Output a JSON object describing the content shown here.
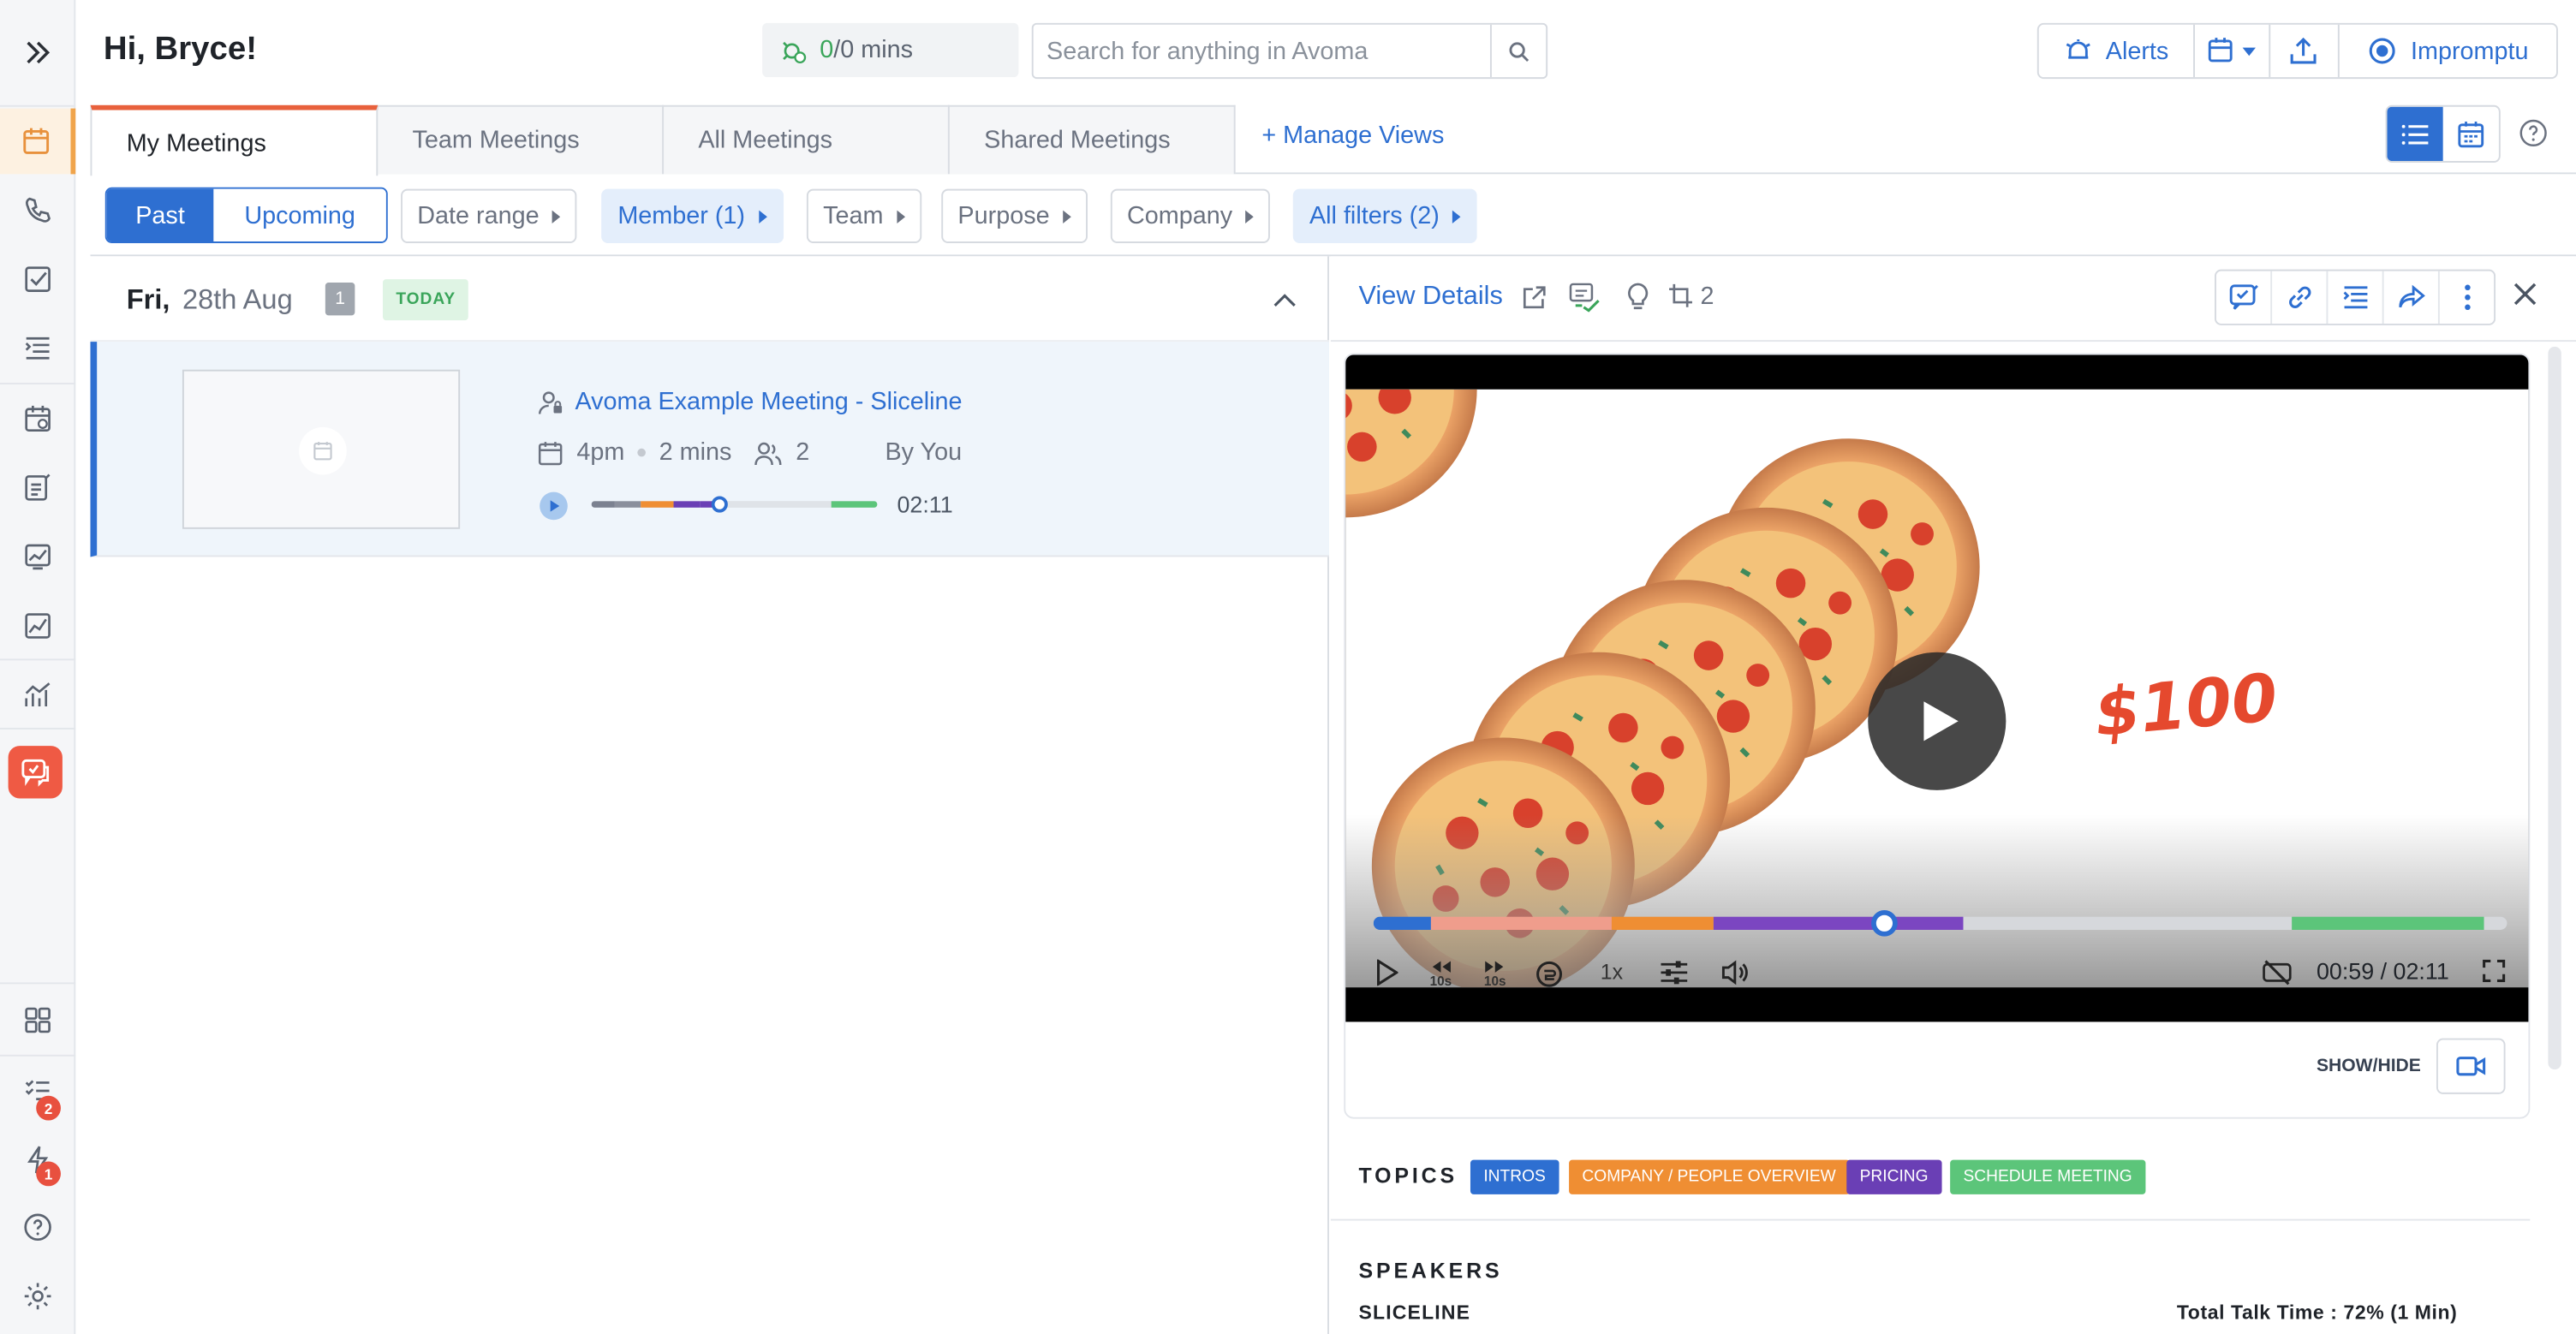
{
  "header": {
    "greeting": "Hi, Bryce!",
    "mins_used": "0",
    "mins_total": "/0 mins",
    "search_placeholder": "Search for anything in Avoma",
    "alerts_label": "Alerts",
    "impromptu_label": "Impromptu"
  },
  "tabs": [
    {
      "label": "My Meetings",
      "active": true
    },
    {
      "label": "Team Meetings"
    },
    {
      "label": "All Meetings"
    },
    {
      "label": "Shared Meetings"
    }
  ],
  "manage_views": "+ Manage Views",
  "filters": {
    "past": "Past",
    "upcoming": "Upcoming",
    "chips": [
      "Date range",
      "Member (1)",
      "Team",
      "Purpose",
      "Company",
      "All filters (2)"
    ]
  },
  "day_group": {
    "day": "Fri,",
    "date": "28th Aug",
    "count": "1",
    "badge": "TODAY"
  },
  "meeting": {
    "title": "Avoma Example Meeting - Sliceline",
    "time": "4pm",
    "length": "2 mins",
    "attendees": "2",
    "owner": "By You",
    "duration": "02:11",
    "progress_fraction": 0.45
  },
  "detail": {
    "view_details": "View Details",
    "clip_count": "2",
    "video": {
      "price_text": "$100",
      "current_time": "00:59",
      "total_time": "02:11",
      "time_display": "00:59 / 02:11",
      "speed": "1x",
      "skip_back": "10s",
      "skip_fwd": "10s",
      "progress_fraction": 0.45
    },
    "show_hide": "SHOW/HIDE",
    "topics_label": "TOPICS",
    "topics": [
      {
        "label": "INTROS",
        "color": "#2e6fd1"
      },
      {
        "label": "COMPANY / PEOPLE OVERVIEW",
        "color": "#ef8e33"
      },
      {
        "label": "PRICING",
        "color": "#6a3fb5"
      },
      {
        "label": "SCHEDULE MEETING",
        "color": "#5cc57a"
      }
    ],
    "speakers_label": "SPEAKERS",
    "speaker_name": "SLICELINE",
    "talk_time": "Total Talk Time : 72% (1 Min)"
  },
  "rail_badges": {
    "tasks": "2",
    "alerts": "1"
  },
  "colors": {
    "accent": "#2e6fd1",
    "tab_active_border": "#e8613c",
    "rail_active": "#f0a44b"
  }
}
